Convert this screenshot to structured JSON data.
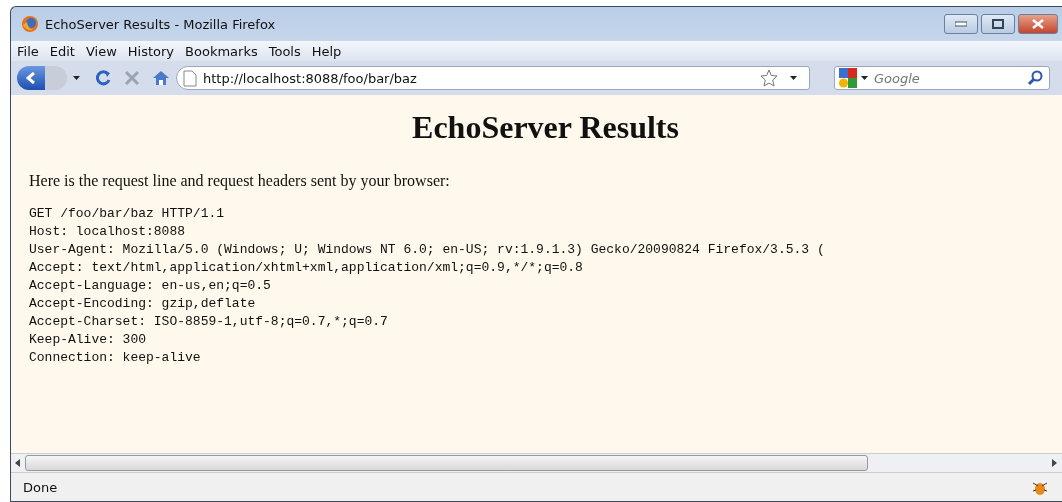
{
  "window": {
    "title": "EchoServer Results - Mozilla Firefox"
  },
  "menu": [
    "File",
    "Edit",
    "View",
    "History",
    "Bookmarks",
    "Tools",
    "Help"
  ],
  "address": {
    "value": "http://localhost:8088/foo/bar/baz"
  },
  "search": {
    "placeholder": "Google"
  },
  "page": {
    "heading": "EchoServer Results",
    "intro": "Here is the request line and request headers sent by your browser:",
    "lines": [
      "GET /foo/bar/baz HTTP/1.1",
      "Host: localhost:8088",
      "User-Agent: Mozilla/5.0 (Windows; U; Windows NT 6.0; en-US; rv:1.9.1.3) Gecko/20090824 Firefox/3.5.3 (",
      "Accept: text/html,application/xhtml+xml,application/xml;q=0.9,*/*;q=0.8",
      "Accept-Language: en-us,en;q=0.5",
      "Accept-Encoding: gzip,deflate",
      "Accept-Charset: ISO-8859-1,utf-8;q=0.7,*;q=0.7",
      "Keep-Alive: 300",
      "Connection: keep-alive"
    ]
  },
  "status_bar": {
    "text": "Done"
  }
}
